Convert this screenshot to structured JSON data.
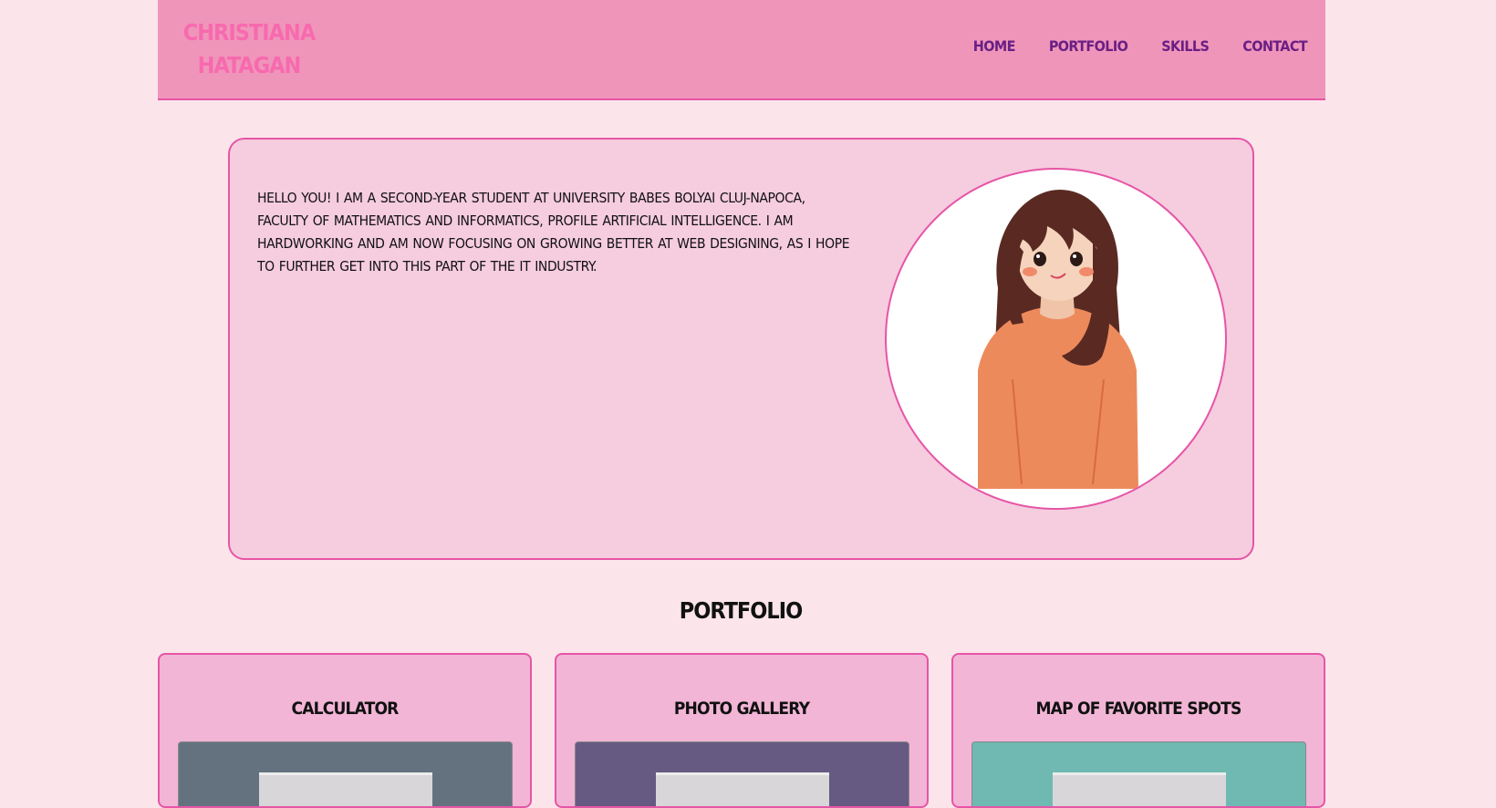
{
  "header": {
    "logo_line1": "CHRISTIANA",
    "logo_line2": "HATAGAN",
    "nav": [
      {
        "label": "HOME"
      },
      {
        "label": "PORTFOLIO"
      },
      {
        "label": "SKILLS"
      },
      {
        "label": "CONTACT"
      }
    ]
  },
  "intro": {
    "text": "HELLO YOU! I AM A SECOND-YEAR STUDENT AT UNIVERSITY BABES BOLYAI CLUJ-NAPOCA, FACULTY OF MATHEMATICS AND INFORMATICS, PROFILE ARTIFICIAL INTELLIGENCE. I AM HARDWORKING AND AM NOW FOCUSING ON GROWING BETTER AT WEB DESIGNING, AS I HOPE TO FURTHER GET INTO THIS PART OF THE IT INDUSTRY."
  },
  "portfolio": {
    "title": "PORTFOLIO",
    "projects": [
      {
        "title": "CALCULATOR",
        "preview_color": "#647280"
      },
      {
        "title": "PHOTO GALLERY",
        "preview_color": "#665a82"
      },
      {
        "title": "MAP OF FAVORITE SPOTS",
        "preview_color": "#6fb9b2"
      }
    ]
  },
  "colors": {
    "page_bg": "#fbe5ea",
    "header_bg": "#f095ba",
    "accent_border": "#e655a6",
    "logo": "#f76aae",
    "nav_text": "#6a1f84",
    "intro_card_bg": "#f6ccdf",
    "project_card_bg": "#f2b5d6"
  }
}
